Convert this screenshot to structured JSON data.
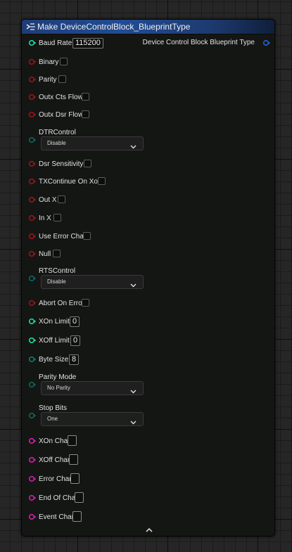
{
  "node": {
    "title": "Make DeviceControlBlock_BlueprintType",
    "output_label": "Device Control Block Blueprint Type"
  },
  "pins": {
    "baud_rate": {
      "label": "Baud Rate",
      "value": "115200"
    },
    "binary": {
      "label": "Binary"
    },
    "parity": {
      "label": "Parity"
    },
    "outx_cts_flow": {
      "label": "Outx Cts Flow"
    },
    "outx_dsr_flow": {
      "label": "Outx Dsr Flow"
    },
    "dtr_control": {
      "label": "DTRControl",
      "value": "Disable"
    },
    "dsr_sensitivity": {
      "label": "Dsr Sensitivity"
    },
    "tx_continue_on_xoff": {
      "label": "TXContinue On Xoff"
    },
    "out_x": {
      "label": "Out X"
    },
    "in_x": {
      "label": "In X"
    },
    "use_error_char": {
      "label": "Use Error Char"
    },
    "null": {
      "label": "Null"
    },
    "rts_control": {
      "label": "RTSControl",
      "value": "Disable"
    },
    "abort_on_error": {
      "label": "Abort On Error"
    },
    "xon_limit": {
      "label": "XOn Limit",
      "value": "0"
    },
    "xoff_limit": {
      "label": "XOff Limit",
      "value": "0"
    },
    "byte_size": {
      "label": "Byte Size",
      "value": "8"
    },
    "parity_mode": {
      "label": "Parity Mode",
      "value": "No Parity"
    },
    "stop_bits": {
      "label": "Stop Bits",
      "value": "One"
    },
    "xon_char": {
      "label": "XOn Char"
    },
    "xoff_char": {
      "label": "XOff Char"
    },
    "error_char": {
      "label": "Error Char"
    },
    "end_of_char": {
      "label": "End Of Char"
    },
    "event_char": {
      "label": "Event Char"
    }
  },
  "colors": {
    "bool_pin": "#9a1414",
    "int_pin": "#1fd6a0",
    "byte_pin": "#0e7a6e",
    "enum_pin": "#0b6660",
    "char_pin": "#cf1fa6",
    "struct_pin": "#1f5fd6"
  },
  "icons": {
    "header": "make-struct-icon",
    "collapse": "chevron-up-icon",
    "dropdown": "chevron-down-icon"
  }
}
